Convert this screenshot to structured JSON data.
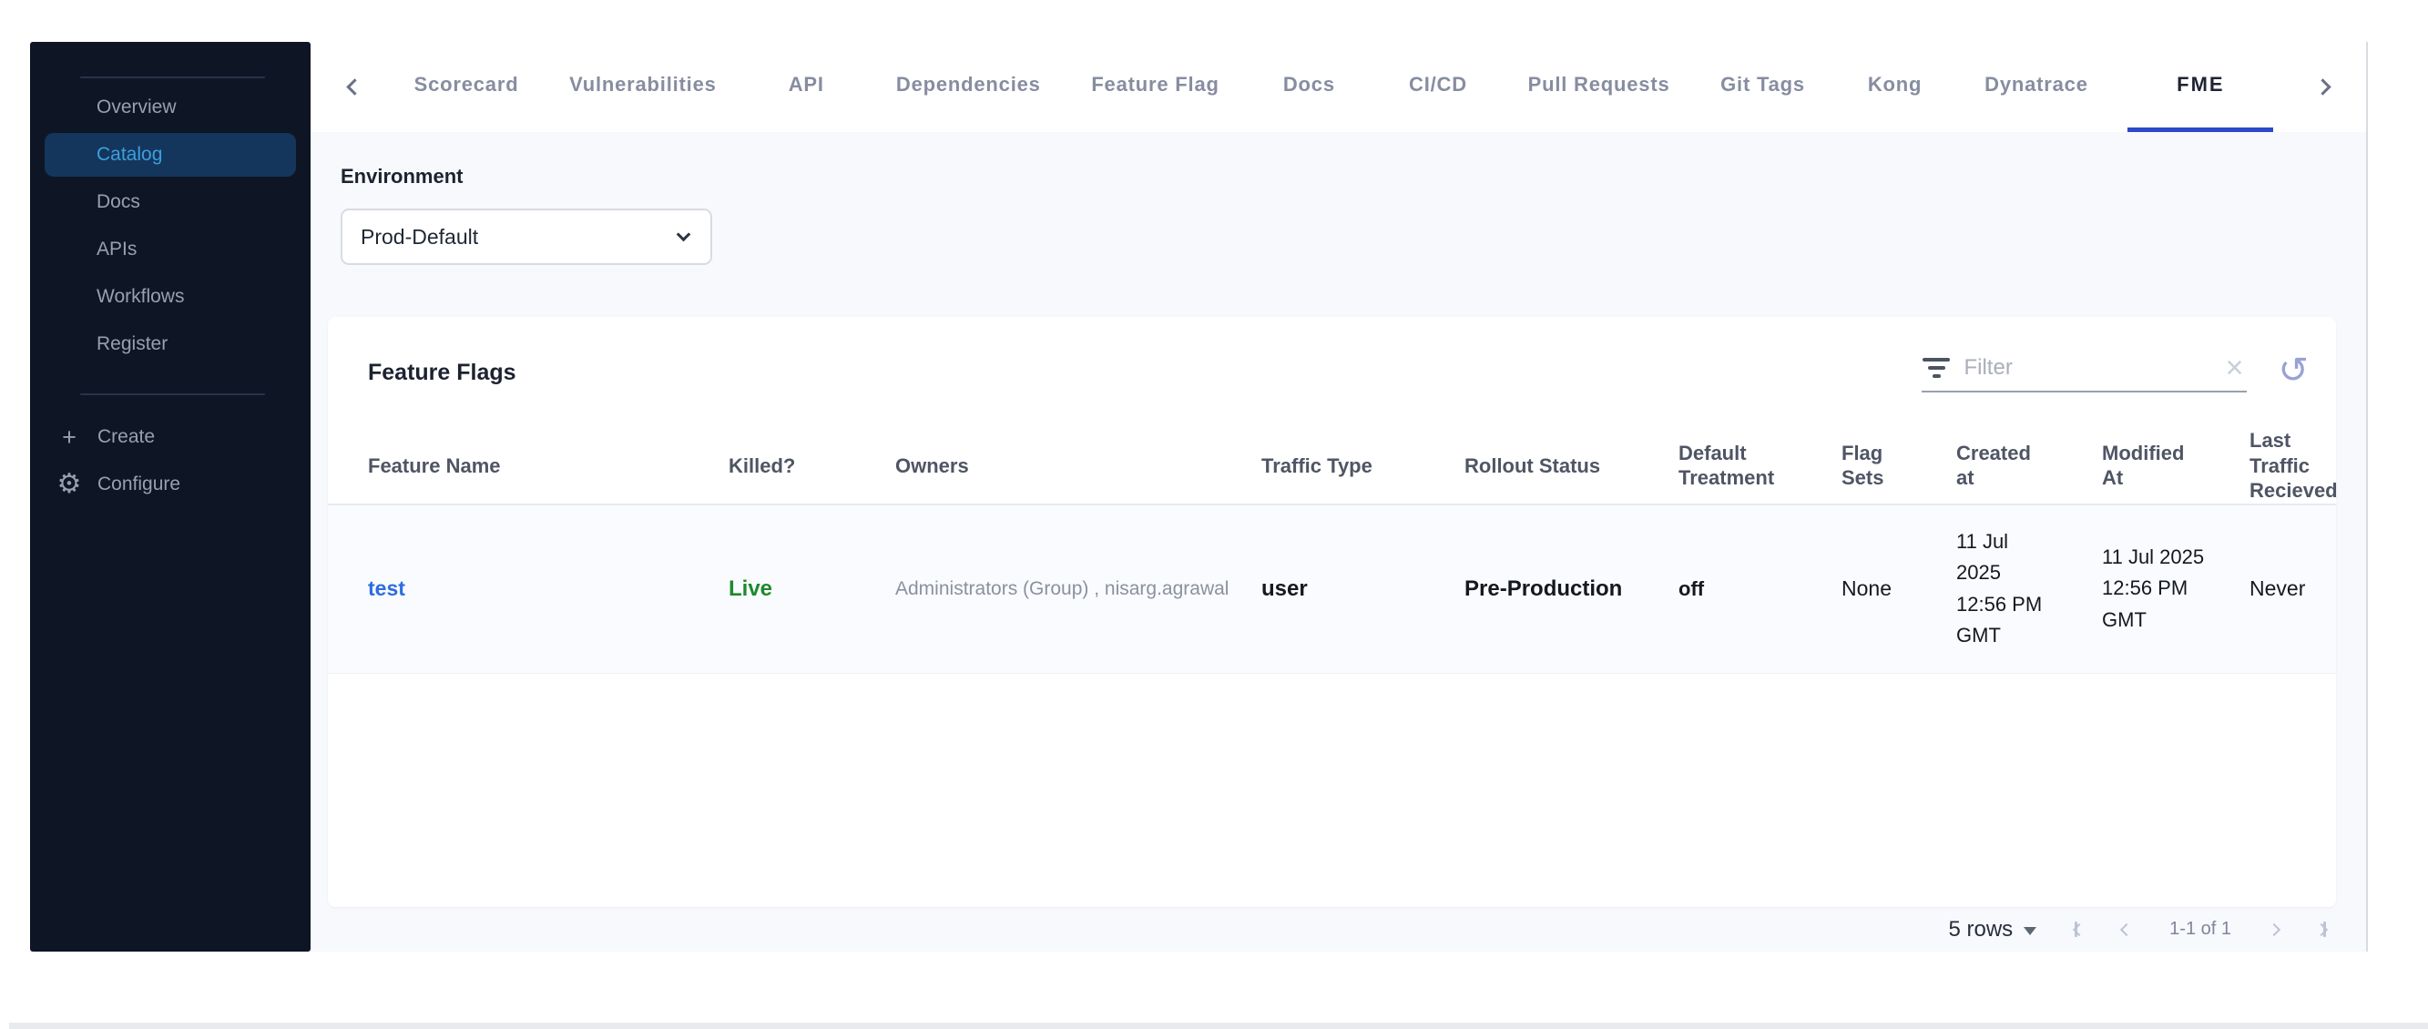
{
  "sidebar": {
    "nav_items": [
      {
        "label": "Overview",
        "active": false
      },
      {
        "label": "Catalog",
        "active": true
      },
      {
        "label": "Docs",
        "active": false
      },
      {
        "label": "APIs",
        "active": false
      },
      {
        "label": "Workflows",
        "active": false
      },
      {
        "label": "Register",
        "active": false
      }
    ],
    "actions": [
      {
        "label": "Create",
        "icon": "plus-icon"
      },
      {
        "label": "Configure",
        "icon": "gear-icon"
      }
    ]
  },
  "tabs": {
    "items": [
      "Scorecard",
      "Vulnerabilities",
      "API",
      "Dependencies",
      "Feature Flag",
      "Docs",
      "CI/CD",
      "Pull Requests",
      "Git Tags",
      "Kong",
      "Dynatrace",
      "FME"
    ],
    "active": "FME"
  },
  "environment": {
    "label": "Environment",
    "selected": "Prod-Default"
  },
  "panel": {
    "title": "Feature Flags",
    "filter_placeholder": "Filter",
    "filter_value": "",
    "table": {
      "columns": [
        "Feature Name",
        "Killed?",
        "Owners",
        "Traffic Type",
        "Rollout Status",
        "Default Treatment",
        "Flag Sets",
        "Created at",
        "Modified At",
        "Last Traffic Recieved"
      ],
      "rows": [
        {
          "feature_name": "test",
          "killed": "Live",
          "owners": "Administrators (Group) , nisarg.agrawal",
          "traffic_type": "user",
          "rollout_status": "Pre-Production",
          "default_treatment": "off",
          "flag_sets": "None",
          "created_at": "11 Jul 2025 12:56 PM GMT",
          "modified_at": "11 Jul 2025 12:56 PM GMT",
          "last_traffic_recieved": "Never"
        }
      ]
    },
    "pagination": {
      "rows_per_page": "5 rows",
      "range": "1-1 of 1"
    }
  },
  "icons": {
    "plus": "+",
    "gear": "⚙",
    "clear": "×",
    "refresh": "↺"
  },
  "colors": {
    "sidebar_bg": "#0e1625",
    "sidebar_selected_bg": "#14365c",
    "sidebar_selected_text": "#3d9fdd",
    "tab_active_underline": "#2b49c9",
    "link_blue": "#2e6ce0",
    "live_green": "#1e8a2d",
    "content_bg": "#f7f9fc"
  }
}
